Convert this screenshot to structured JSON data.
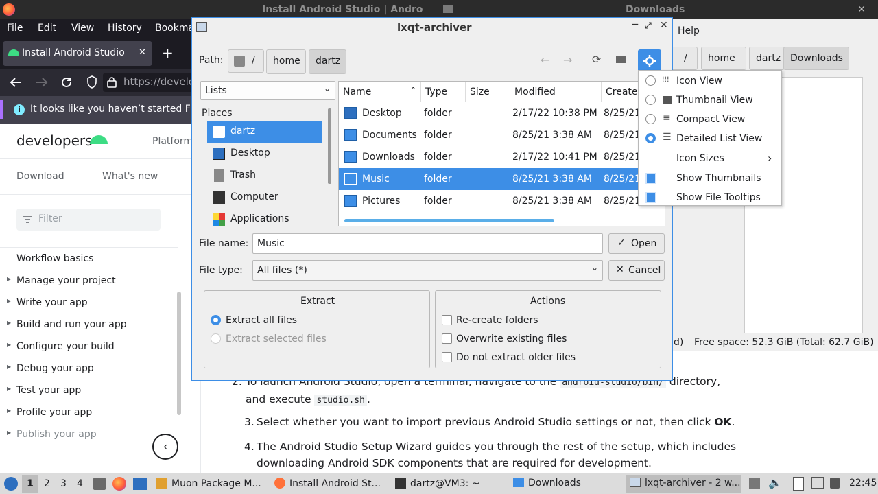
{
  "top_strip": {
    "left_title": "Install Android Studio  |  Andro",
    "right_title": "Downloads",
    "close": "✕"
  },
  "firefox": {
    "menu": [
      "File",
      "Edit",
      "View",
      "History",
      "Bookma"
    ],
    "tab_title": "Install Android Studio",
    "tab_close": "✕",
    "new_tab": "+",
    "url": "https://develo",
    "notification": "It looks like you haven’t started Fire",
    "brand": "developers",
    "platform_link": "Platform",
    "subnav": [
      "Download",
      "What's new"
    ],
    "filter_placeholder": "Filter",
    "nav_items": [
      {
        "label": "Workflow basics",
        "arrow": ""
      },
      {
        "label": "Manage your project",
        "arrow": "▶"
      },
      {
        "label": "Write your app",
        "arrow": "▶"
      },
      {
        "label": "Build and run your app",
        "arrow": "▶"
      },
      {
        "label": "Configure your build",
        "arrow": "▶"
      },
      {
        "label": "Debug your app",
        "arrow": "▶"
      },
      {
        "label": "Test your app",
        "arrow": "▶"
      },
      {
        "label": "Profile your app",
        "arrow": "▶"
      },
      {
        "label": "Publish your app",
        "arrow": "▶"
      }
    ],
    "collapse": "‹"
  },
  "page_steps": [
    {
      "num": "2.",
      "text_a": "To launch Android Studio, open a terminal, navigate to the ",
      "code": "android-studio/bin/",
      "text_b": " directory,",
      "line2_a": "and execute ",
      "line2_code": "studio.sh",
      "line2_b": "."
    },
    {
      "num": "3.",
      "text": "Select whether you want to import previous Android Studio settings or not, then click ",
      "bold": "OK",
      "end": "."
    },
    {
      "num": "4.",
      "text": "The Android Studio Setup Wizard guides you through the rest of the setup, which includes",
      "line2": "downloading Android SDK components that are required for development."
    }
  ],
  "file_manager": {
    "help_menu": "Help",
    "crumbs": [
      "/",
      "home",
      "dartz",
      "Downloads"
    ],
    "status_left": "d)",
    "status_free": "Free space: 52.3 GiB (Total: 62.7 GiB)"
  },
  "dialog": {
    "title": "lxqt-archiver",
    "path_label": "Path:",
    "path_crumbs": [
      "/",
      "home",
      "dartz"
    ],
    "places_combo": "Lists",
    "places_header": "Places",
    "places": [
      {
        "label": "dartz",
        "icon": "home-icon"
      },
      {
        "label": "Desktop",
        "icon": "desktop-icon"
      },
      {
        "label": "Trash",
        "icon": "trash-icon"
      },
      {
        "label": "Computer",
        "icon": "computer-icon"
      },
      {
        "label": "Applications",
        "icon": "applications-icon"
      }
    ],
    "columns": [
      "Name",
      "Type",
      "Size",
      "Modified",
      "Created"
    ],
    "files": [
      {
        "name": "Desktop",
        "type": "folder",
        "size": "",
        "modified": "2/17/22 10:38 PM",
        "created": "8/25/21"
      },
      {
        "name": "Documents",
        "type": "folder",
        "size": "",
        "modified": "8/25/21 3:38 AM",
        "created": "8/25/21"
      },
      {
        "name": "Downloads",
        "type": "folder",
        "size": "",
        "modified": "2/17/22 10:41 PM",
        "created": "8/25/21"
      },
      {
        "name": "Music",
        "type": "folder",
        "size": "",
        "modified": "8/25/21 3:38 AM",
        "created": "8/25/21"
      },
      {
        "name": "Pictures",
        "type": "folder",
        "size": "",
        "modified": "8/25/21 3:38 AM",
        "created": "8/25/21"
      }
    ],
    "file_name_label": "File name:",
    "file_name_value": "Music",
    "open_label": "Open",
    "file_type_label": "File type:",
    "file_type_value": "All files (*)",
    "cancel_label": "Cancel",
    "extract_title": "Extract",
    "extract_all": "Extract all files",
    "extract_selected": "Extract selected files",
    "actions_title": "Actions",
    "actions": [
      "Re-create folders",
      "Overwrite existing files",
      "Do not extract older files"
    ]
  },
  "view_menu": {
    "items": [
      {
        "label": "Icon View",
        "kind": "radio",
        "checked": false
      },
      {
        "label": "Thumbnail View",
        "kind": "radio",
        "checked": false
      },
      {
        "label": "Compact View",
        "kind": "radio",
        "checked": false
      },
      {
        "label": "Detailed List View",
        "kind": "radio",
        "checked": true
      },
      {
        "label": "Icon Sizes",
        "kind": "submenu",
        "checked": false
      },
      {
        "label": "Show Thumbnails",
        "kind": "check",
        "checked": true
      },
      {
        "label": "Show File Tooltips",
        "kind": "check",
        "checked": true
      }
    ],
    "submenu_arrow": "›"
  },
  "taskbar": {
    "desktops": [
      "1",
      "2",
      "3",
      "4"
    ],
    "tasks": [
      "Muon Package M...",
      "Install Android St...",
      "dartz@VM3: ~",
      "Downloads",
      "lxqt-archiver - 2 w..."
    ],
    "clock": "22:45"
  },
  "colors": {
    "accent": "#3d8ee6",
    "android_green": "#3ddc84",
    "firefox_dark": "#1c1b22"
  }
}
